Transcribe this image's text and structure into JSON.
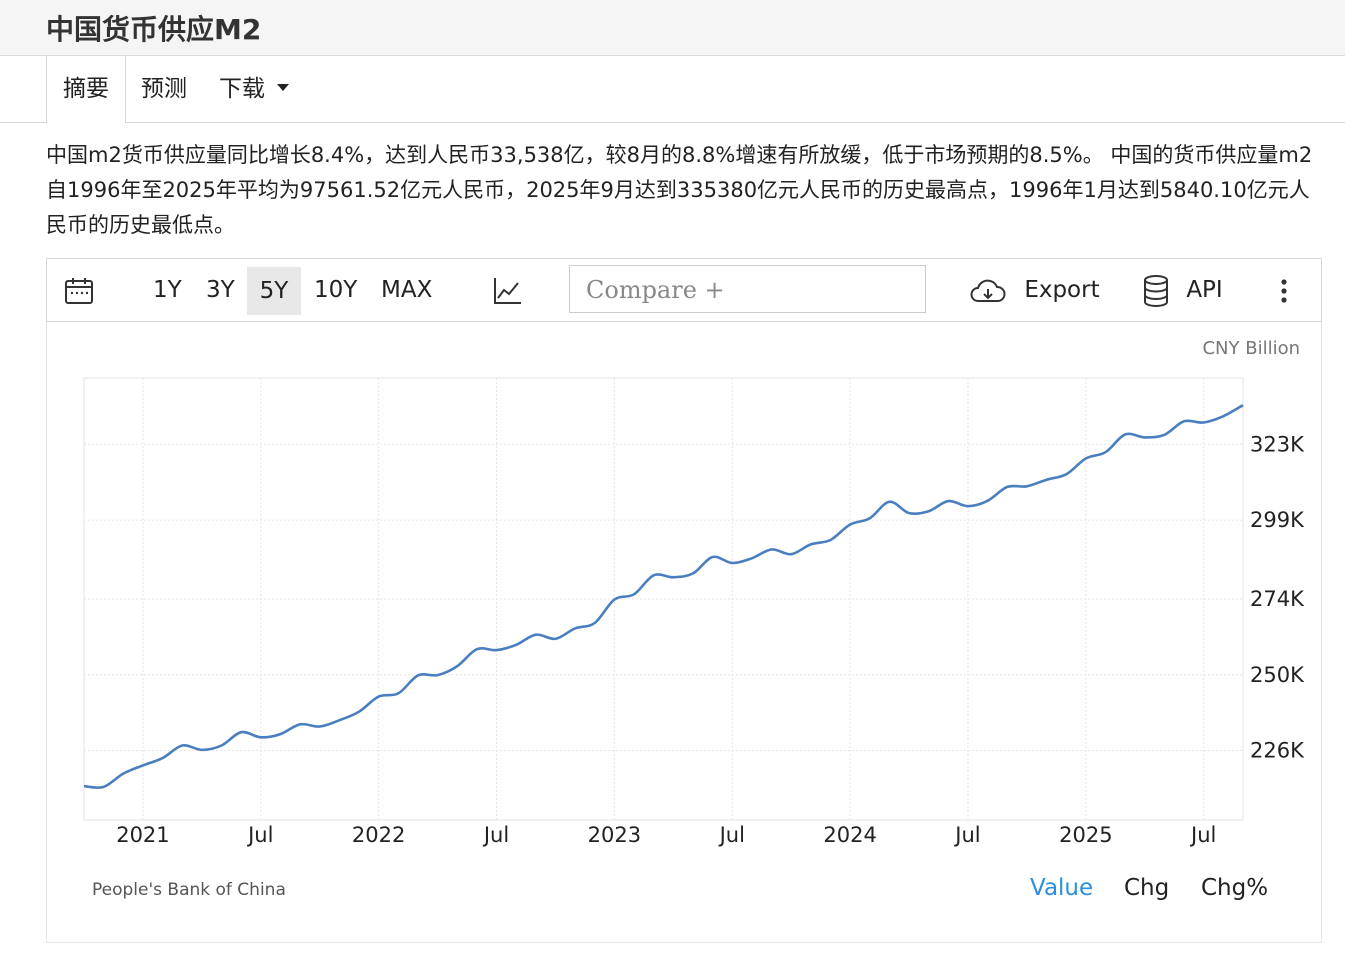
{
  "page": {
    "title": "中国货币供应M2"
  },
  "tabs": [
    {
      "label": "摘要",
      "active": true
    },
    {
      "label": "预测",
      "active": false
    },
    {
      "label": "下载",
      "active": false
    }
  ],
  "summary": "中国m2货币供应量同比增长8.4%，达到人民币33,538亿，较8月的8.8%增速有所放缓，低于市场预期的8.5%。 中国的货币供应量m2自1996年至2025年平均为97561.52亿元人民币，2025年9月达到335380亿元人民币的历史最高点，1996年1月达到5840.10亿元人民币的历史最低点。",
  "toolbar": {
    "ranges": [
      "1Y",
      "3Y",
      "5Y",
      "10Y",
      "MAX"
    ],
    "selected_range": "5Y",
    "compare_placeholder": "Compare +",
    "export_label": "Export",
    "api_label": "API"
  },
  "chart_data": {
    "type": "line",
    "unit": "CNY Billion",
    "x_ticks": [
      "2021",
      "Jul",
      "2022",
      "Jul",
      "2023",
      "Jul",
      "2024",
      "Jul",
      "2025",
      "Jul"
    ],
    "y_ticks": [
      "226K",
      "250K",
      "274K",
      "299K",
      "323K"
    ],
    "y_tick_values": [
      226000,
      250000,
      274000,
      299000,
      323000
    ],
    "ylim": [
      204000,
      344000
    ],
    "x_range": [
      "2020-10",
      "2025-09"
    ],
    "grid": true,
    "series": [
      {
        "color": "#4a7fbf",
        "points": [
          [
            "2020-10",
            214700
          ],
          [
            "2020-11",
            214500
          ],
          [
            "2020-12",
            218700
          ],
          [
            "2021-01",
            221300
          ],
          [
            "2021-02",
            223600
          ],
          [
            "2021-03",
            227600
          ],
          [
            "2021-04",
            226200
          ],
          [
            "2021-05",
            227600
          ],
          [
            "2021-06",
            231800
          ],
          [
            "2021-07",
            230200
          ],
          [
            "2021-08",
            231200
          ],
          [
            "2021-09",
            234300
          ],
          [
            "2021-10",
            233600
          ],
          [
            "2021-11",
            235600
          ],
          [
            "2021-12",
            238300
          ],
          [
            "2022-01",
            243100
          ],
          [
            "2022-02",
            244100
          ],
          [
            "2022-03",
            249800
          ],
          [
            "2022-04",
            249900
          ],
          [
            "2022-05",
            252700
          ],
          [
            "2022-06",
            258100
          ],
          [
            "2022-07",
            257800
          ],
          [
            "2022-08",
            259500
          ],
          [
            "2022-09",
            262700
          ],
          [
            "2022-10",
            261400
          ],
          [
            "2022-11",
            264700
          ],
          [
            "2022-12",
            266400
          ],
          [
            "2023-01",
            273800
          ],
          [
            "2023-02",
            275500
          ],
          [
            "2023-03",
            281500
          ],
          [
            "2023-04",
            280900
          ],
          [
            "2023-05",
            282100
          ],
          [
            "2023-06",
            287300
          ],
          [
            "2023-07",
            285400
          ],
          [
            "2023-08",
            286900
          ],
          [
            "2023-09",
            289700
          ],
          [
            "2023-10",
            288200
          ],
          [
            "2023-11",
            291300
          ],
          [
            "2023-12",
            292700
          ],
          [
            "2024-01",
            297600
          ],
          [
            "2024-02",
            299600
          ],
          [
            "2024-03",
            304800
          ],
          [
            "2024-04",
            301200
          ],
          [
            "2024-05",
            301800
          ],
          [
            "2024-06",
            305000
          ],
          [
            "2024-07",
            303400
          ],
          [
            "2024-08",
            305100
          ],
          [
            "2024-09",
            309500
          ],
          [
            "2024-10",
            309700
          ],
          [
            "2024-11",
            311800
          ],
          [
            "2024-12",
            313500
          ],
          [
            "2025-01",
            318500
          ],
          [
            "2025-02",
            320500
          ],
          [
            "2025-03",
            326100
          ],
          [
            "2025-04",
            325200
          ],
          [
            "2025-05",
            326000
          ],
          [
            "2025-06",
            330300
          ],
          [
            "2025-07",
            329900
          ],
          [
            "2025-08",
            331900
          ],
          [
            "2025-09",
            335400
          ]
        ]
      }
    ],
    "source": "People's Bank of China",
    "view_modes": [
      "Value",
      "Chg",
      "Chg%"
    ],
    "active_view": "Value"
  },
  "icons": {
    "calendar": "calendar-icon",
    "chart_type": "line-chart-icon",
    "export": "cloud-download-icon",
    "api": "database-icon",
    "more": "more-vertical-icon"
  },
  "colors": {
    "line": "#4a7fbf",
    "active_view": "#2a8fe0",
    "selected_range_bg": "#e8e8e8"
  }
}
